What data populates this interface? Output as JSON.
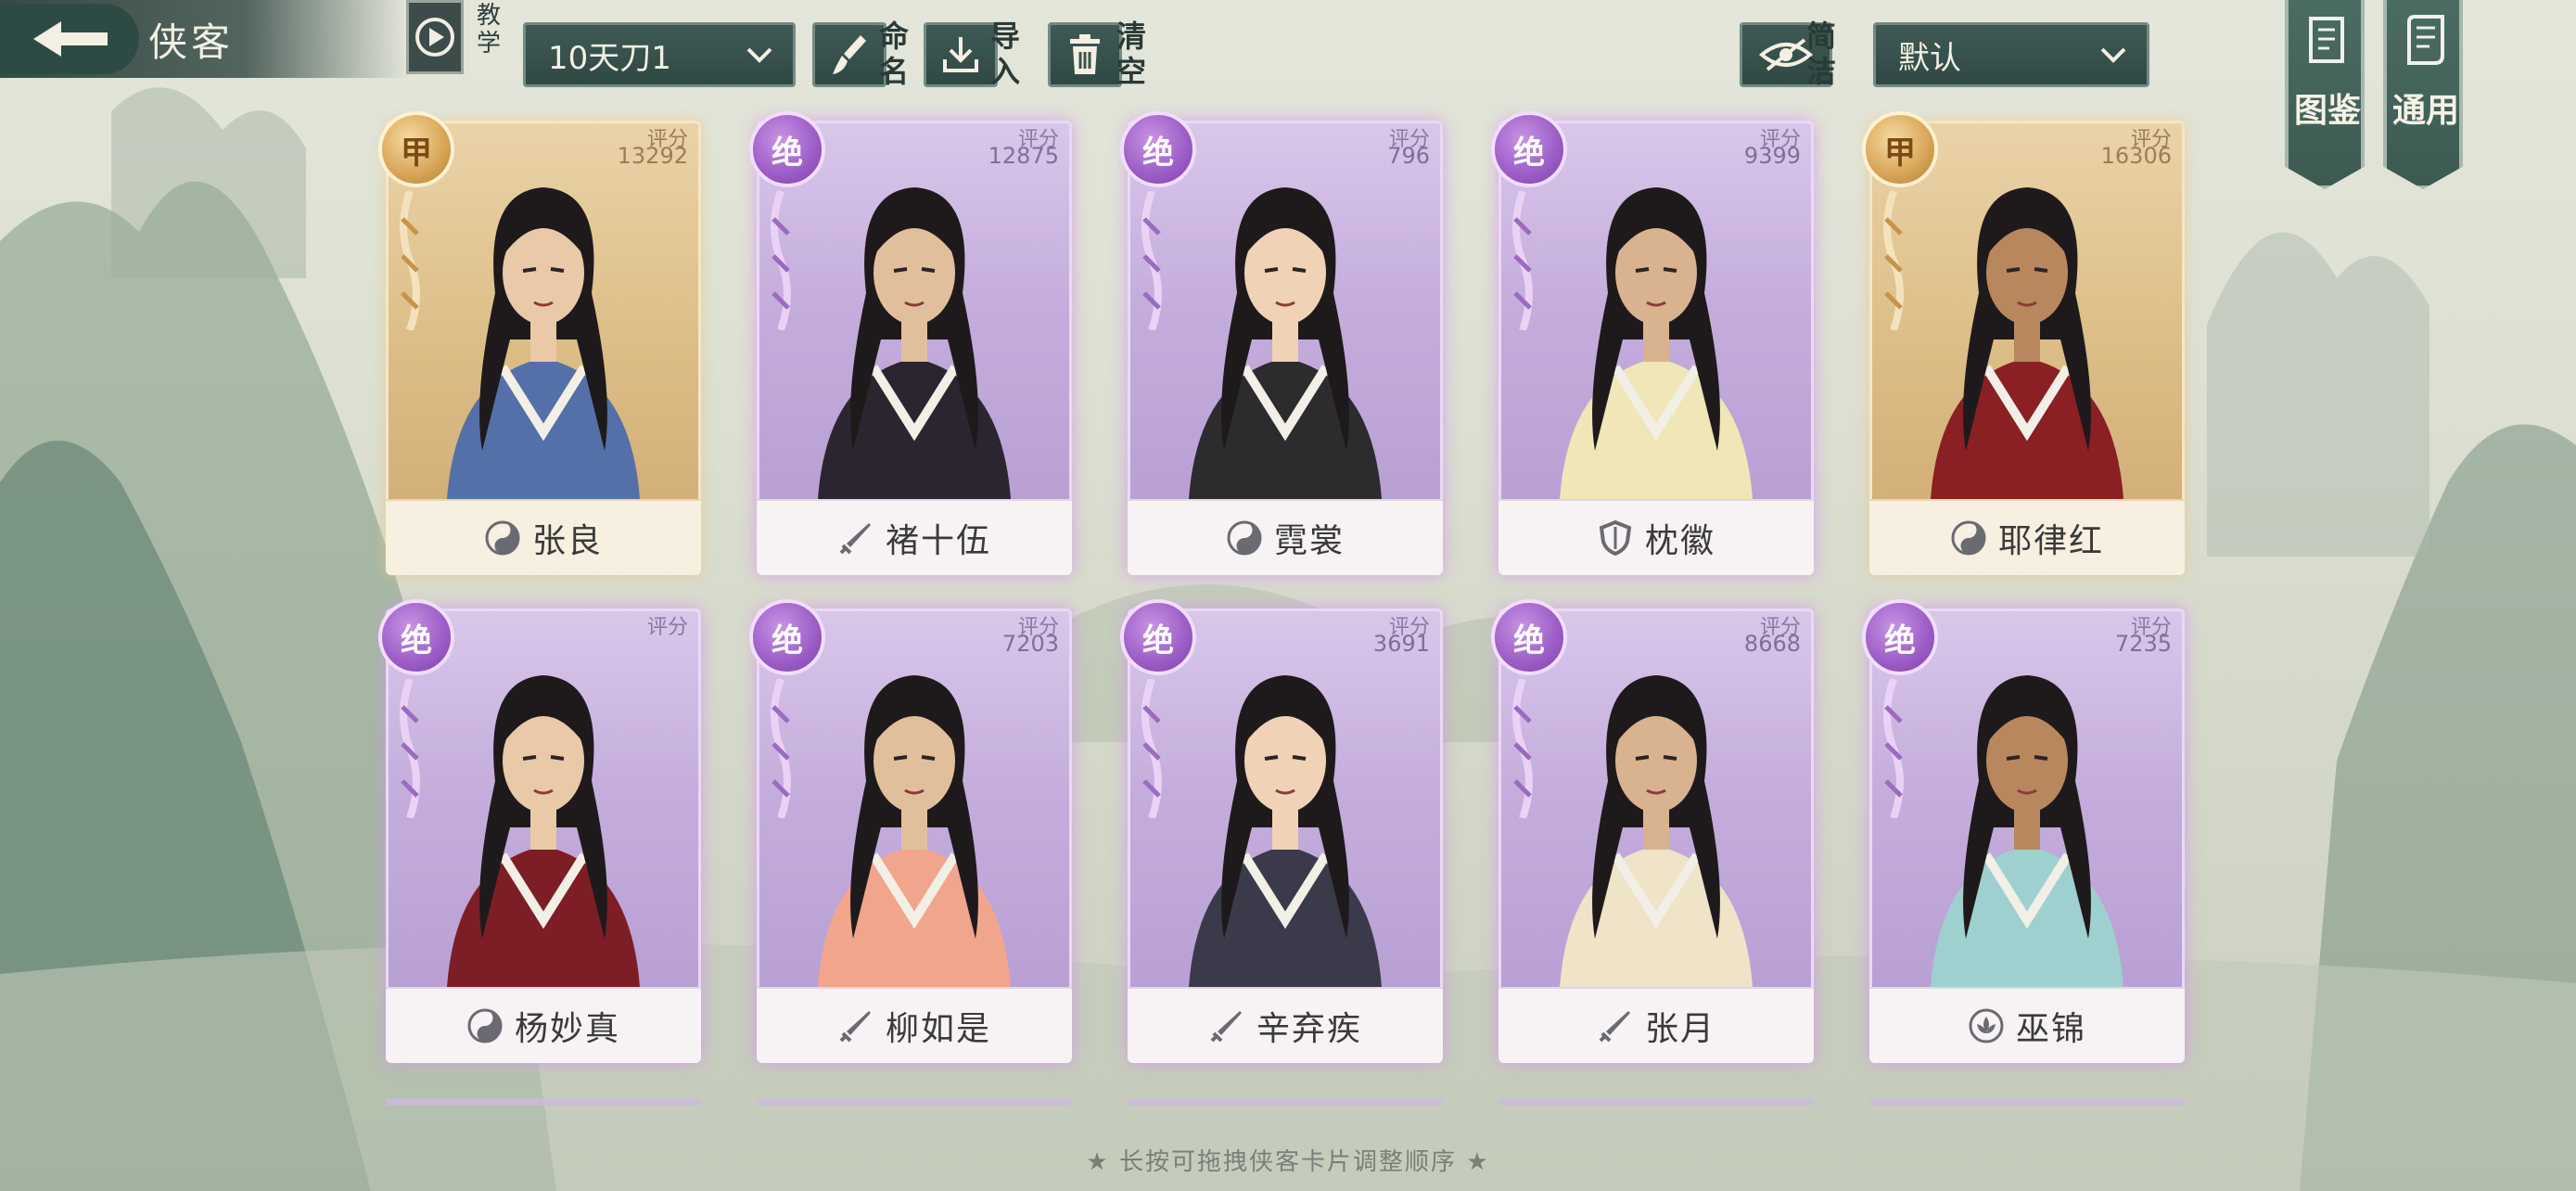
{
  "header": {
    "title": "侠客",
    "tutorial_label": "教学",
    "team_select": "10天刀1",
    "rename_label": "命名",
    "import_label": "导入",
    "clear_label": "清空",
    "simple_label": "简洁",
    "sort_select": "默认"
  },
  "banners": {
    "compendium": "图鉴",
    "general": "通用"
  },
  "score_label": "评分",
  "cards": [
    {
      "name": "张良",
      "rank": "甲",
      "score": "13292",
      "tier": "gold",
      "class_icon": "yinyang-icon"
    },
    {
      "name": "褚十伍",
      "rank": "绝",
      "score": "12875",
      "tier": "purple",
      "class_icon": "sword-icon"
    },
    {
      "name": "霓裳",
      "rank": "绝",
      "score": "796",
      "tier": "purple",
      "class_icon": "yinyang-icon"
    },
    {
      "name": "枕徽",
      "rank": "绝",
      "score": "9399",
      "tier": "purple",
      "class_icon": "shield-icon"
    },
    {
      "name": "耶律红",
      "rank": "甲",
      "score": "16306",
      "tier": "gold",
      "class_icon": "yinyang-icon"
    },
    {
      "name": "杨妙真",
      "rank": "绝",
      "score": "",
      "tier": "purple",
      "class_icon": "yinyang-icon"
    },
    {
      "name": "柳如是",
      "rank": "绝",
      "score": "7203",
      "tier": "purple",
      "class_icon": "sword-icon"
    },
    {
      "name": "辛弃疾",
      "rank": "绝",
      "score": "3691",
      "tier": "purple",
      "class_icon": "sword-icon"
    },
    {
      "name": "张月",
      "rank": "绝",
      "score": "8668",
      "tier": "purple",
      "class_icon": "sword-icon"
    },
    {
      "name": "巫锦",
      "rank": "绝",
      "score": "7235",
      "tier": "purple",
      "class_icon": "lotus-icon"
    }
  ],
  "hint": "★ 长按可拖拽侠客卡片调整顺序 ★",
  "colors": {
    "panel": "#2f4844",
    "purple_glow": "#d696eb",
    "gold": "#d7a456"
  }
}
